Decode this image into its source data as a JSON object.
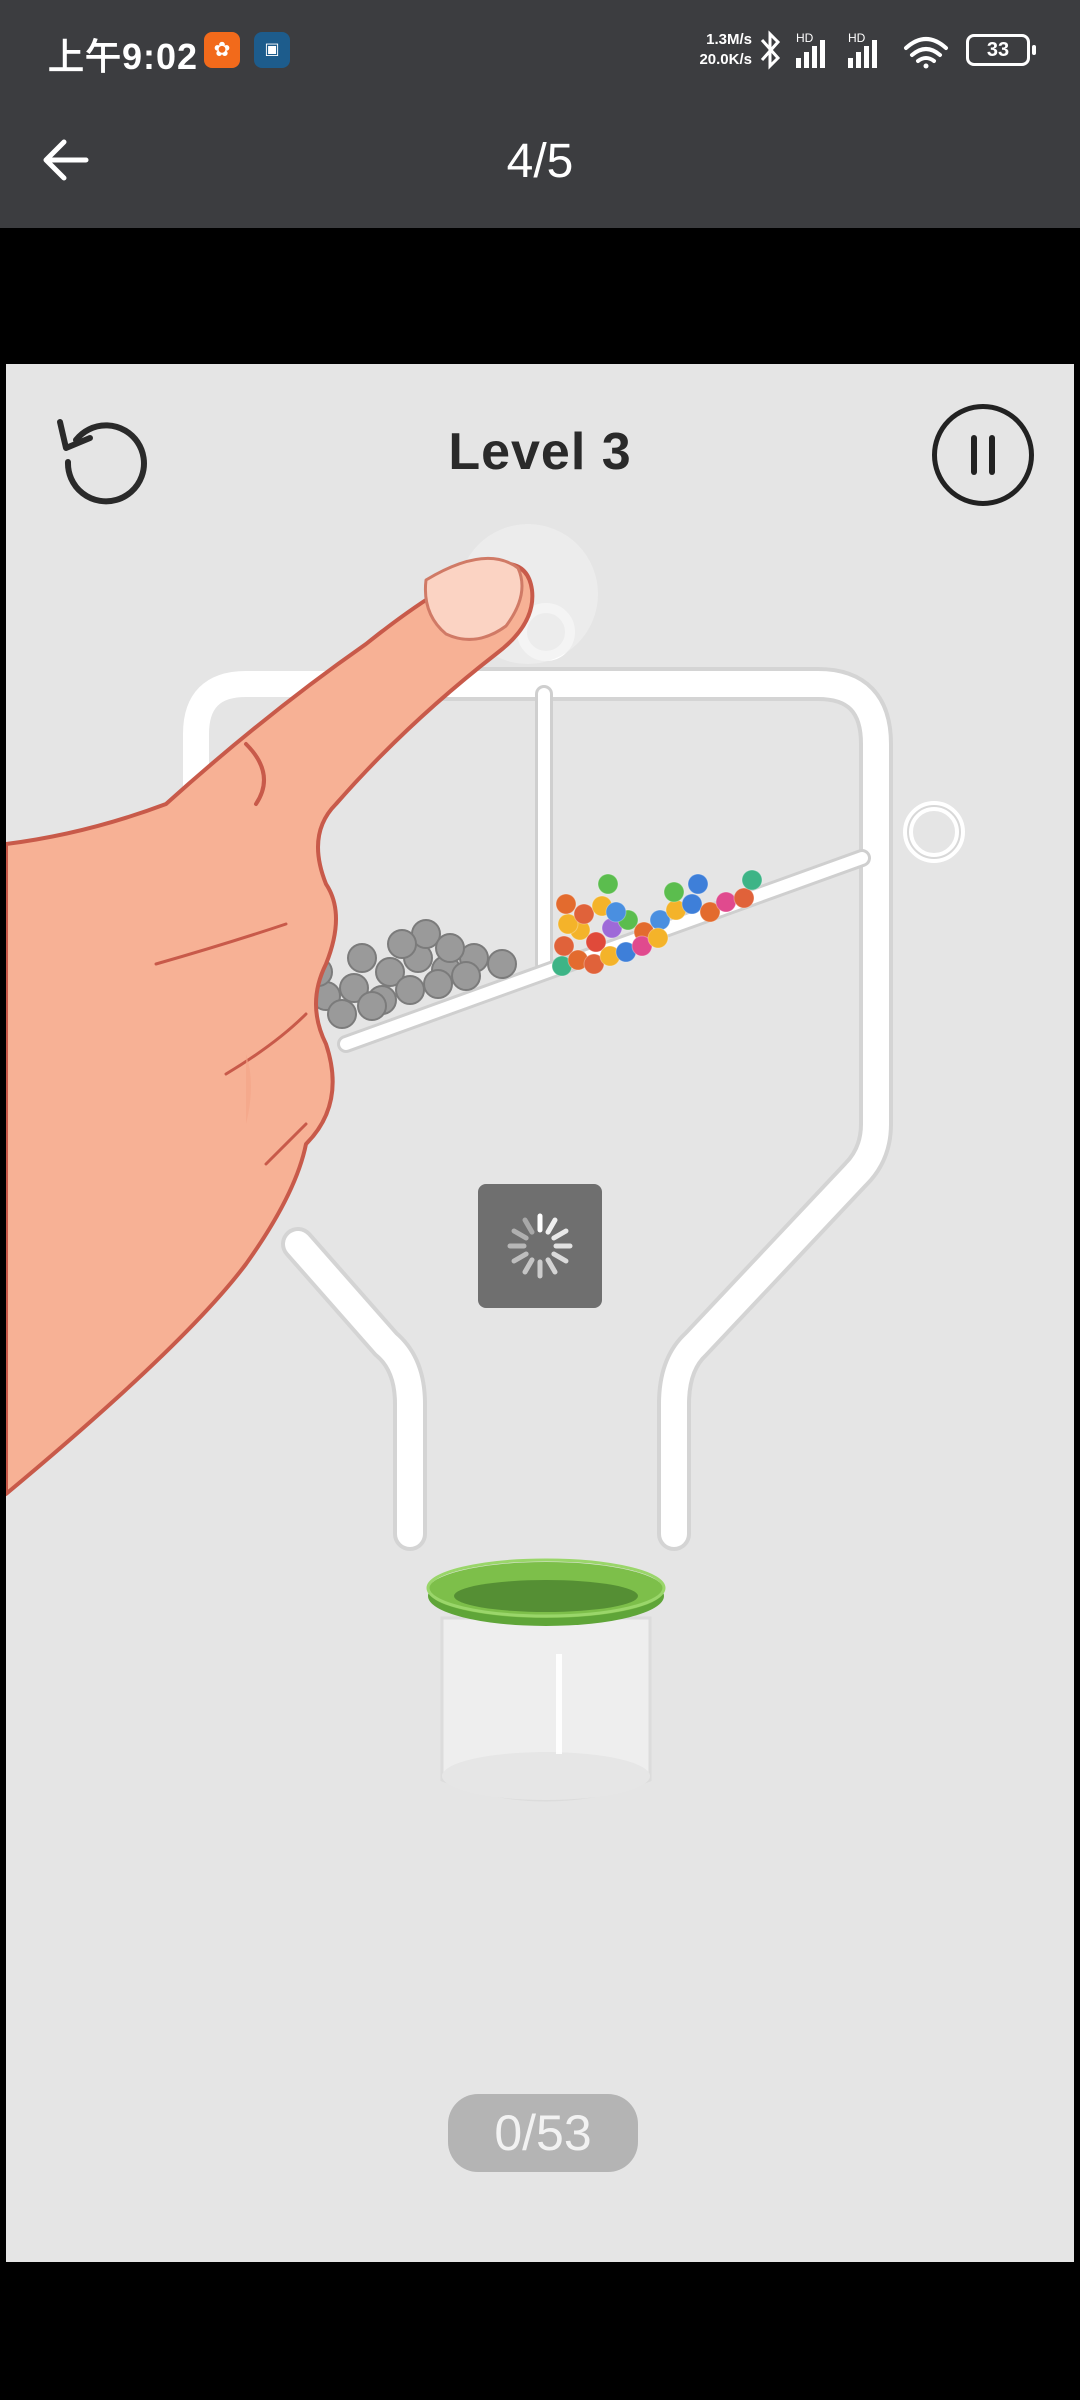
{
  "status_bar": {
    "time": "上午9:02",
    "app_icon_1": "app-notification-icon",
    "app_icon_2": "app-notification-icon",
    "net_up": "1.3M/s",
    "net_down": "20.0K/s",
    "signal_1_label": "HD",
    "signal_2_label": "HD",
    "battery": "33"
  },
  "header": {
    "page_counter": "4/5"
  },
  "game": {
    "level_title": "Level 3",
    "ball_counter": "0/53",
    "colors": {
      "background": "#e5e5e5",
      "pipe": "#ffffff",
      "cup_rim": "#7dbf4a",
      "finger": "#f7b195"
    }
  }
}
